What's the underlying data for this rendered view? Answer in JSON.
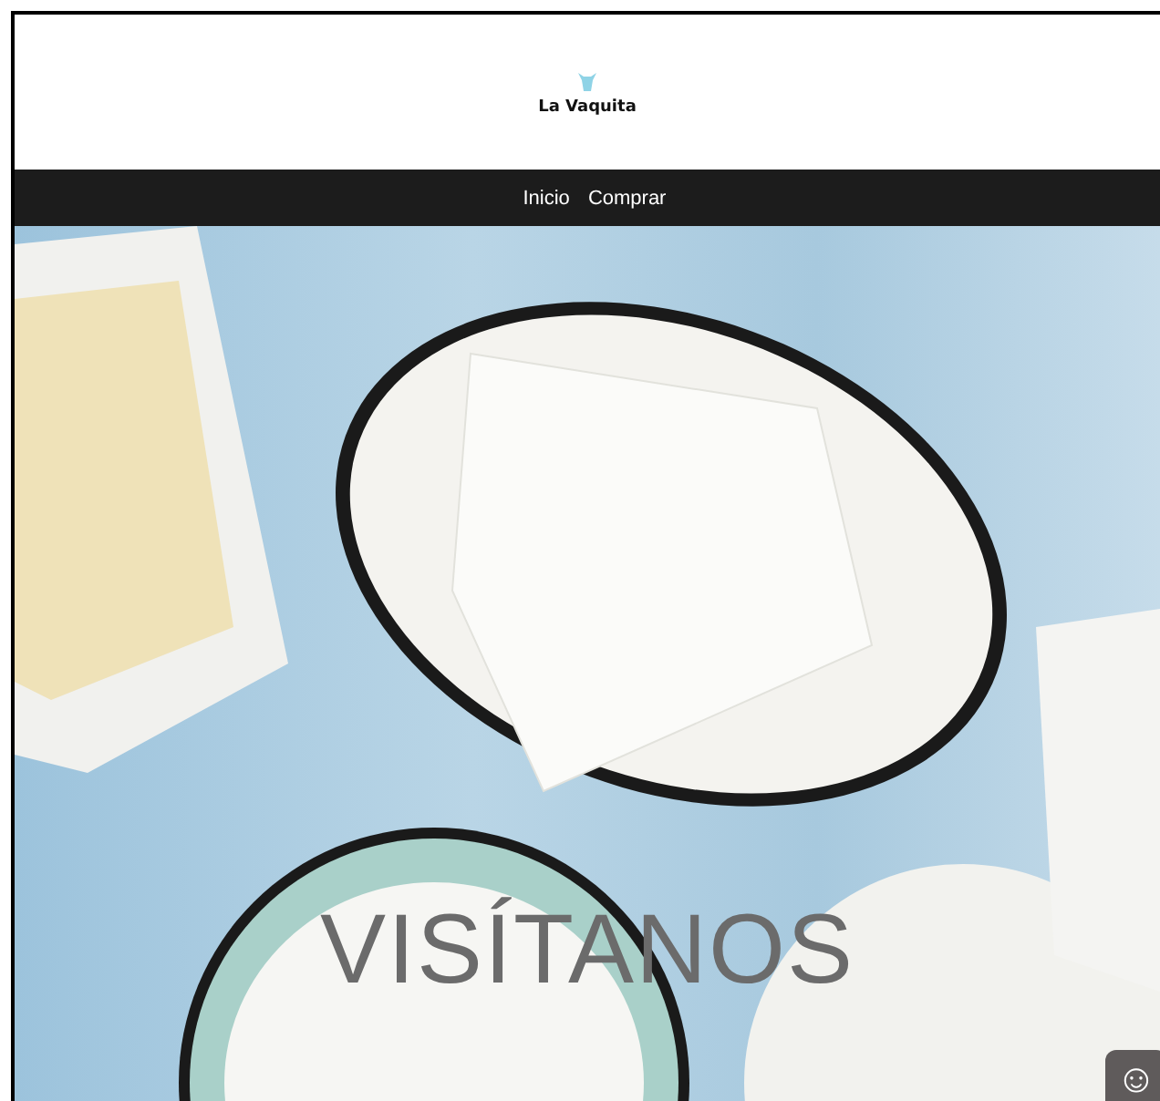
{
  "header": {
    "logo_text": "La Vaquita"
  },
  "nav": {
    "items": [
      {
        "label": "Inicio"
      },
      {
        "label": "Comprar"
      }
    ]
  },
  "hero": {
    "title": "VISÍTANOS"
  },
  "chat_button": {
    "icon": "☺"
  }
}
